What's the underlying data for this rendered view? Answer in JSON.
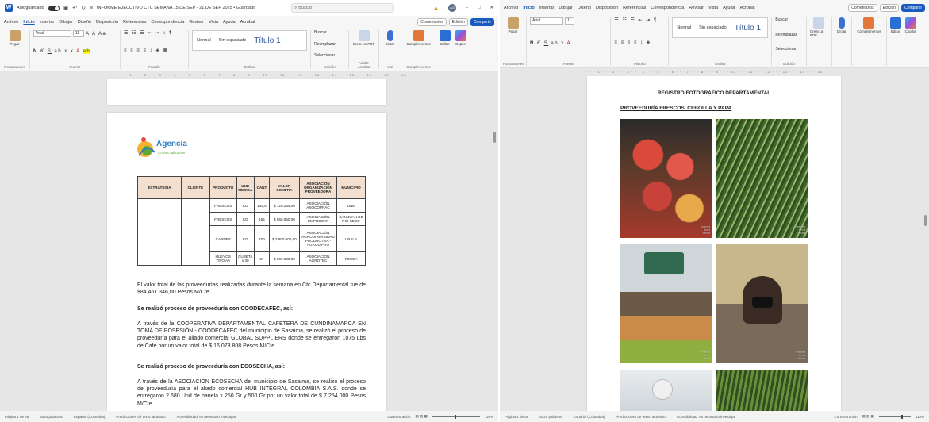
{
  "left": {
    "titlebar": {
      "autosave": "Autoguardado",
      "title": "INFORME EJECUTIVO CTC SEMANA 15 DE SEP - 21 DE SEP 2025 • Guardado",
      "search_placeholder": "Buscar",
      "user_initials": "AO",
      "minimize": "–",
      "restore": "□",
      "close": "✕"
    },
    "menu": {
      "tabs": [
        "Archivo",
        "Inicio",
        "Insertar",
        "Dibujar",
        "Diseño",
        "Disposición",
        "Referencias",
        "Correspondencia",
        "Revisar",
        "Vista",
        "Ayuda",
        "Acrobat"
      ],
      "comments": "Comentarios",
      "edit": "Edición",
      "share": "Compartir"
    },
    "ribbon": {
      "paste": "Pegar",
      "clipboard": "Portapapeles",
      "font_name": "Arial",
      "font_size": "11",
      "font_group": "Fuente",
      "paragraph_group": "Párrafo",
      "style_normal": "Normal",
      "style_nospacing": "Sin espaciado",
      "style_title": "Título 1",
      "styles_group": "Estilos",
      "find": "Buscar",
      "replace": "Reemplazar",
      "select": "Seleccionar",
      "edit_group": "Edición",
      "create_pdf": "Crear un PDF",
      "acrobat_group": "Adobe Acrobat",
      "dictate": "Dictar",
      "voice_group": "Voz",
      "addins": "Complementos",
      "addins_group": "Complementos",
      "editor": "Editor",
      "copilot": "Copilot"
    },
    "doc": {
      "logo_text": "Agencia",
      "logo_sub": "Comercialización",
      "table": {
        "headers": [
          "ESTRATEGIA",
          "CLIENTE",
          "PRODUCTO",
          "UND MEDIDA",
          "CANT",
          "VALOR COMPRA",
          "ASOCIACIÓN ORGANIZACIÓN PROVEEDORA",
          "MUNICIPIO"
        ],
        "rows": [
          [
            "FRESCOS",
            "KG",
            "145,5",
            "$ 129.264,00",
            "ASOCIACIÓN ASOCOPRAC",
            "UNE"
          ],
          [
            "FRESCOS",
            "KG",
            "165",
            "$ 556.050,00",
            "ASOCIACIÓN EMPROCAF",
            "SAN JUAN DE RIO SECO"
          ],
          [
            "CARNES",
            "KG",
            "100",
            "$ 2.800.000,00",
            "ASOCIACIÓN AGRODIVERSIDAD PRODUCTIVA - AGRODIPRO",
            "UBALA"
          ],
          [
            "HUEVOS TIPO AA",
            "CUBETA x 30",
            "27",
            "$ 369.900,00",
            "ASOCIACIÓN AGROTEC",
            "FOSCA"
          ]
        ]
      },
      "p1": "El valor total de las proveedurías realizadas durante la semana en Ctc Departamental fue de $84.461.346,00 Pesos M/Cte.",
      "h1": "Se realizó proceso de proveeduría con COODECAFEC, así:",
      "p2": "A través de la COOPERATIVA DEPARTAMENTAL CAFETERA DE CUNDINAMARCA EN TOMA DE POSESIÓN - COODECAFEC del municipio de Sasaima, se realizó el proceso de proveeduría para el aliado comercial GLOBAL SUPPLIERS donde se entregaron 1075 Lbs de Café por un valor total de $ 16.073.808 Pesos M/Cte.",
      "h2": "Se realizó proceso de proveeduría con ECOSECHA, así:",
      "p3": "A través de la ASOCIACIÓN ECOSECHA del municipio de Sasaima, se realizó el proceso de proveeduría para el aliado comercial HUB INTEGRAL COLOMBIA S.A.S. donde se entregaron 2.680 Und de panela x 250 Gr y 500 Gr por un valor total de $ 7.254.000 Pesos M/Cte."
    },
    "status": {
      "page": "Página 1 de 46",
      "words": "5420 palabras",
      "language": "Español (Colombia)",
      "predictions": "Predicciones de texto: activado",
      "accessibility": "Accesibilidad: es necesario investigar",
      "focus": "Concentración",
      "zoom": "110%"
    }
  },
  "right": {
    "menu": {
      "tabs": [
        "Archivo",
        "Inicio",
        "Insertar",
        "Dibujar",
        "Diseño",
        "Disposición",
        "Referencias",
        "Correspondencia",
        "Revisar",
        "Vista",
        "Ayuda",
        "Acrobat"
      ],
      "comments": "Comentarios",
      "edit": "Edición",
      "share": "Compartir"
    },
    "doc": {
      "title": "REGISTRO FOTOGRÁFICO DEPARTAMENTAL",
      "subtitle": "PROVEEDURÍA FRESCOS, CEBOLLA Y PAPA"
    },
    "status": {
      "page": "Página 1 de 46",
      "words": "5420 palabras",
      "language": "Español (Colombia)",
      "predictions": "Predicciones de texto: activado",
      "accessibility": "Accesibilidad: es necesario investigar",
      "focus": "Concentración",
      "zoom": "110%"
    }
  },
  "colors": {
    "word_blue": "#185abd",
    "table_header": "#f2dfd0",
    "title_blue": "#2f5496"
  }
}
